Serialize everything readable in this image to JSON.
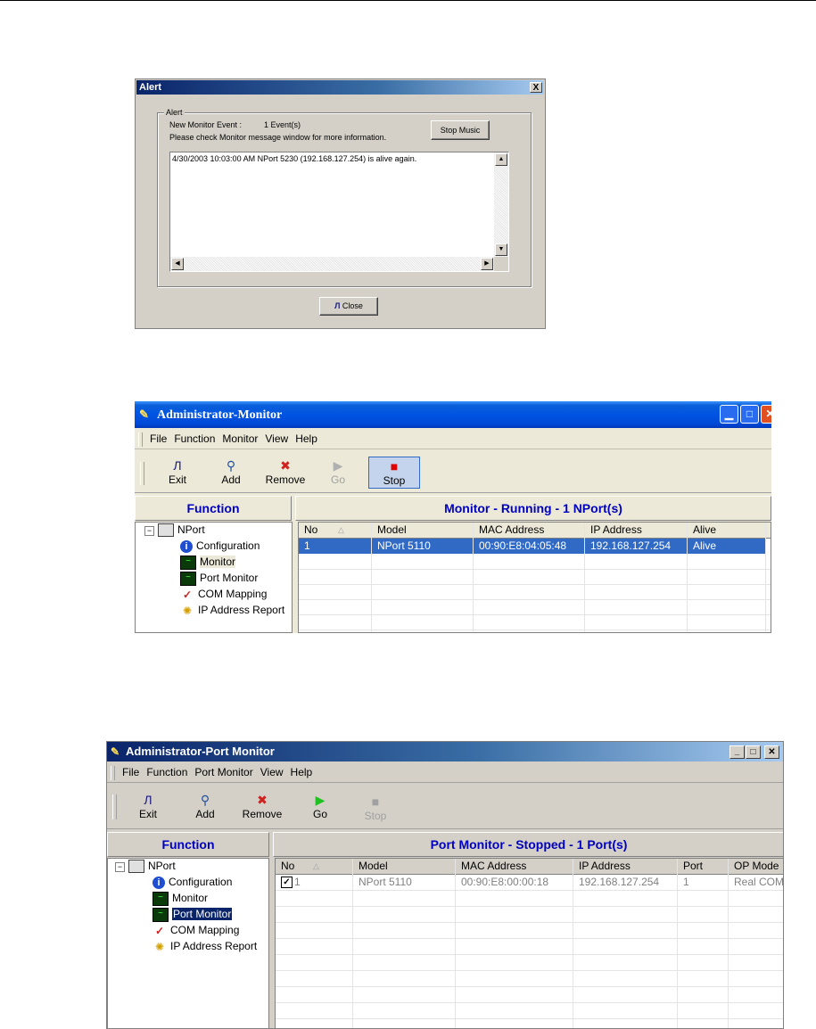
{
  "alert": {
    "title": "Alert",
    "close_glyph": "X",
    "group_label": "Alert",
    "event_label": "New Monitor Event :",
    "event_count": "1 Event(s)",
    "info_text": "Please check Monitor message window for more information.",
    "stop_music_label": "Stop Music",
    "message": "4/30/2003 10:03:00 AM NPort 5230 (192.168.127.254) is alive again.",
    "close_label": "Close"
  },
  "monitor": {
    "title": "Administrator-Monitor",
    "menu": [
      "File",
      "Function",
      "Monitor",
      "View",
      "Help"
    ],
    "toolbar": [
      {
        "label": "Exit",
        "icon": "exit-icon",
        "enabled": true
      },
      {
        "label": "Add",
        "icon": "add-icon",
        "enabled": true
      },
      {
        "label": "Remove",
        "icon": "remove-icon",
        "enabled": true
      },
      {
        "label": "Go",
        "icon": "go-icon",
        "enabled": false
      },
      {
        "label": "Stop",
        "icon": "stop-icon",
        "enabled": true
      }
    ],
    "function_header": "Function",
    "status_header": "Monitor - Running - 1 NPort(s)",
    "tree": {
      "root": "NPort",
      "items": [
        "Configuration",
        "Monitor",
        "Port Monitor",
        "COM Mapping",
        "IP Address Report"
      ],
      "selected": "Monitor"
    },
    "columns": [
      "No",
      "Model",
      "MAC Address",
      "IP Address",
      "Alive"
    ],
    "rows": [
      {
        "no": "1",
        "model": "NPort 5110",
        "mac": "00:90:E8:04:05:48",
        "ip": "192.168.127.254",
        "alive": "Alive"
      }
    ]
  },
  "port_monitor": {
    "title": "Administrator-Port Monitor",
    "menu": [
      "File",
      "Function",
      "Port Monitor",
      "View",
      "Help"
    ],
    "toolbar": [
      {
        "label": "Exit",
        "icon": "exit-icon",
        "enabled": true
      },
      {
        "label": "Add",
        "icon": "add-icon",
        "enabled": true
      },
      {
        "label": "Remove",
        "icon": "remove-icon",
        "enabled": true
      },
      {
        "label": "Go",
        "icon": "go-icon",
        "enabled": true
      },
      {
        "label": "Stop",
        "icon": "stop-icon",
        "enabled": false
      }
    ],
    "function_header": "Function",
    "status_header": "Port Monitor - Stopped - 1 Port(s)",
    "tree": {
      "root": "NPort",
      "items": [
        "Configuration",
        "Monitor",
        "Port Monitor",
        "COM Mapping",
        "IP Address Report"
      ],
      "selected": "Port Monitor"
    },
    "columns": [
      "No",
      "Model",
      "MAC Address",
      "IP Address",
      "Port",
      "OP Mode"
    ],
    "rows": [
      {
        "no": "1",
        "model": "NPort 5110",
        "mac": "00:90:E8:00:00:18",
        "ip": "192.168.127.254",
        "port": "1",
        "op_mode": "Real COM",
        "checked": true
      }
    ]
  },
  "colors": {
    "header_text": "#0000c0",
    "selection": "#316ac5",
    "xp_title": "#0054e3",
    "classic_title": "#0a246a"
  }
}
